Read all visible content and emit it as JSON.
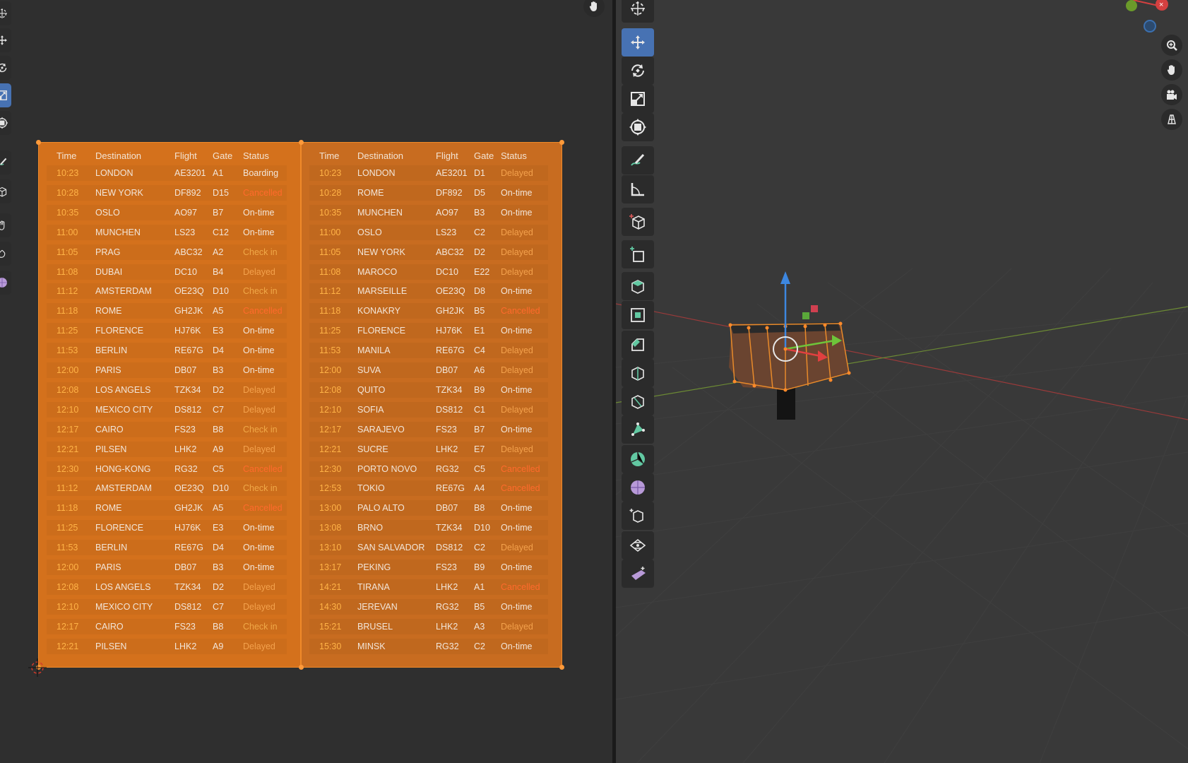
{
  "board": {
    "headers": {
      "time": "Time",
      "destination": "Destination",
      "flight": "Flight",
      "gate": "Gate",
      "status": "Status"
    },
    "left_rows": [
      {
        "time": "10:23",
        "dest": "LONDON",
        "flight": "AE3201",
        "gate": "A1",
        "status": "Boarding",
        "kind": "normal"
      },
      {
        "time": "10:28",
        "dest": "NEW YORK",
        "flight": "DF892",
        "gate": "D15",
        "status": "Cancelled",
        "kind": "cancel"
      },
      {
        "time": "10:35",
        "dest": "OSLO",
        "flight": "AO97",
        "gate": "B7",
        "status": "On-time",
        "kind": "normal"
      },
      {
        "time": "11:00",
        "dest": "MUNCHEN",
        "flight": "LS23",
        "gate": "C12",
        "status": "On-time",
        "kind": "normal"
      },
      {
        "time": "11:05",
        "dest": "PRAG",
        "flight": "ABC32",
        "gate": "A2",
        "status": "Check in",
        "kind": "check"
      },
      {
        "time": "11:08",
        "dest": "DUBAI",
        "flight": "DC10",
        "gate": "B4",
        "status": "Delayed",
        "kind": "delayed"
      },
      {
        "time": "11:12",
        "dest": "AMSTERDAM",
        "flight": "OE23Q",
        "gate": "D10",
        "status": "Check in",
        "kind": "check"
      },
      {
        "time": "11:18",
        "dest": "ROME",
        "flight": "GH2JK",
        "gate": "A5",
        "status": "Cancelled",
        "kind": "cancel"
      },
      {
        "time": "11:25",
        "dest": "FLORENCE",
        "flight": "HJ76K",
        "gate": "E3",
        "status": "On-time",
        "kind": "normal"
      },
      {
        "time": "11:53",
        "dest": "BERLIN",
        "flight": "RE67G",
        "gate": "D4",
        "status": "On-time",
        "kind": "normal"
      },
      {
        "time": "12:00",
        "dest": "PARIS",
        "flight": "DB07",
        "gate": "B3",
        "status": "On-time",
        "kind": "normal"
      },
      {
        "time": "12:08",
        "dest": "LOS ANGELS",
        "flight": "TZK34",
        "gate": "D2",
        "status": "Delayed",
        "kind": "delayed"
      },
      {
        "time": "12:10",
        "dest": "MEXICO CITY",
        "flight": "DS812",
        "gate": "C7",
        "status": "Delayed",
        "kind": "delayed"
      },
      {
        "time": "12:17",
        "dest": "CAIRO",
        "flight": "FS23",
        "gate": "B8",
        "status": "Check in",
        "kind": "check"
      },
      {
        "time": "12:21",
        "dest": "PILSEN",
        "flight": "LHK2",
        "gate": "A9",
        "status": "Delayed",
        "kind": "delayed"
      },
      {
        "time": "12:30",
        "dest": "HONG-KONG",
        "flight": "RG32",
        "gate": "C5",
        "status": "Cancelled",
        "kind": "cancel"
      },
      {
        "time": "11:12",
        "dest": "AMSTERDAM",
        "flight": "OE23Q",
        "gate": "D10",
        "status": "Check in",
        "kind": "check"
      },
      {
        "time": "11:18",
        "dest": "ROME",
        "flight": "GH2JK",
        "gate": "A5",
        "status": "Cancelled",
        "kind": "cancel"
      },
      {
        "time": "11:25",
        "dest": "FLORENCE",
        "flight": "HJ76K",
        "gate": "E3",
        "status": "On-time",
        "kind": "normal"
      },
      {
        "time": "11:53",
        "dest": "BERLIN",
        "flight": "RE67G",
        "gate": "D4",
        "status": "On-time",
        "kind": "normal"
      },
      {
        "time": "12:00",
        "dest": "PARIS",
        "flight": "DB07",
        "gate": "B3",
        "status": "On-time",
        "kind": "normal"
      },
      {
        "time": "12:08",
        "dest": "LOS ANGELS",
        "flight": "TZK34",
        "gate": "D2",
        "status": "Delayed",
        "kind": "delayed"
      },
      {
        "time": "12:10",
        "dest": "MEXICO CITY",
        "flight": "DS812",
        "gate": "C7",
        "status": "Delayed",
        "kind": "delayed"
      },
      {
        "time": "12:17",
        "dest": "CAIRO",
        "flight": "FS23",
        "gate": "B8",
        "status": "Check in",
        "kind": "check"
      },
      {
        "time": "12:21",
        "dest": "PILSEN",
        "flight": "LHK2",
        "gate": "A9",
        "status": "Delayed",
        "kind": "delayed"
      }
    ],
    "right_rows": [
      {
        "time": "10:23",
        "dest": "LONDON",
        "flight": "AE3201",
        "gate": "D1",
        "status": "Delayed",
        "kind": "delayed"
      },
      {
        "time": "10:28",
        "dest": "ROME",
        "flight": "DF892",
        "gate": "D5",
        "status": "On-time",
        "kind": "normal"
      },
      {
        "time": "10:35",
        "dest": "MUNCHEN",
        "flight": "AO97",
        "gate": "B3",
        "status": "On-time",
        "kind": "normal"
      },
      {
        "time": "11:00",
        "dest": "OSLO",
        "flight": "LS23",
        "gate": "C2",
        "status": "Delayed",
        "kind": "delayed"
      },
      {
        "time": "11:05",
        "dest": "NEW YORK",
        "flight": "ABC32",
        "gate": "D2",
        "status": "Delayed",
        "kind": "delayed"
      },
      {
        "time": "11:08",
        "dest": "MAROCO",
        "flight": "DC10",
        "gate": "E22",
        "status": "Delayed",
        "kind": "delayed"
      },
      {
        "time": "11:12",
        "dest": "MARSEILLE",
        "flight": "OE23Q",
        "gate": "D8",
        "status": "On-time",
        "kind": "normal"
      },
      {
        "time": "11:18",
        "dest": "KONAKRY",
        "flight": "GH2JK",
        "gate": "B5",
        "status": "Cancelled",
        "kind": "cancel"
      },
      {
        "time": "11:25",
        "dest": "FLORENCE",
        "flight": "HJ76K",
        "gate": "E1",
        "status": "On-time",
        "kind": "normal"
      },
      {
        "time": "11:53",
        "dest": "MANILA",
        "flight": "RE67G",
        "gate": "C4",
        "status": "Delayed",
        "kind": "delayed"
      },
      {
        "time": "12:00",
        "dest": "SUVA",
        "flight": "DB07",
        "gate": "A6",
        "status": "Delayed",
        "kind": "delayed"
      },
      {
        "time": "12:08",
        "dest": "QUITO",
        "flight": "TZK34",
        "gate": "B9",
        "status": "On-time",
        "kind": "normal"
      },
      {
        "time": "12:10",
        "dest": "SOFIA",
        "flight": "DS812",
        "gate": "C1",
        "status": "Delayed",
        "kind": "delayed"
      },
      {
        "time": "12:17",
        "dest": "SARAJEVO",
        "flight": "FS23",
        "gate": "B7",
        "status": "On-time",
        "kind": "normal"
      },
      {
        "time": "12:21",
        "dest": "SUCRE",
        "flight": "LHK2",
        "gate": "E7",
        "status": "Delayed",
        "kind": "delayed"
      },
      {
        "time": "12:30",
        "dest": "PORTO NOVO",
        "flight": "RG32",
        "gate": "C5",
        "status": "Cancelled",
        "kind": "cancel"
      },
      {
        "time": "12:53",
        "dest": "TOKIO",
        "flight": "RE67G",
        "gate": "A4",
        "status": "Cancelled",
        "kind": "cancel"
      },
      {
        "time": "13:00",
        "dest": "PALO ALTO",
        "flight": "DB07",
        "gate": "B8",
        "status": "On-time",
        "kind": "normal"
      },
      {
        "time": "13:08",
        "dest": "BRNO",
        "flight": "TZK34",
        "gate": "D10",
        "status": "On-time",
        "kind": "normal"
      },
      {
        "time": "13:10",
        "dest": "SAN SALVADOR",
        "flight": "DS812",
        "gate": "C2",
        "status": "Delayed",
        "kind": "delayed"
      },
      {
        "time": "13:17",
        "dest": "PEKING",
        "flight": "FS23",
        "gate": "B9",
        "status": "On-time",
        "kind": "normal"
      },
      {
        "time": "14:21",
        "dest": "TIRANA",
        "flight": "LHK2",
        "gate": "A1",
        "status": "Cancelled",
        "kind": "cancel"
      },
      {
        "time": "14:30",
        "dest": "JEREVAN",
        "flight": "RG32",
        "gate": "B5",
        "status": "On-time",
        "kind": "normal"
      },
      {
        "time": "15:21",
        "dest": "BRUSEL",
        "flight": "LHK2",
        "gate": "A3",
        "status": "Delayed",
        "kind": "delayed"
      },
      {
        "time": "15:30",
        "dest": "MINSK",
        "flight": "RG32",
        "gate": "C2",
        "status": "On-time",
        "kind": "normal"
      }
    ]
  },
  "left_toolbar": {
    "tools": [
      "cursor-icon",
      "move-icon",
      "rotate-icon",
      "scale-icon",
      "transform-icon",
      "annotate-icon",
      "cube-icon",
      "grab-icon",
      "pinch-icon",
      "smooth-icon"
    ],
    "active": "scale-icon"
  },
  "viewport_toolbar": {
    "tools": [
      "cursor-icon",
      "move-icon",
      "rotate-icon",
      "scale-icon",
      "transform-icon",
      "annotate-icon",
      "measure-icon",
      "add-cube-icon",
      "add-primitive-icon",
      "extrude-icon",
      "inset-icon",
      "bevel-icon",
      "loop-cut-icon",
      "knife-icon",
      "poly-build-icon",
      "spin-icon",
      "smooth-icon",
      "shrink-fatten-icon",
      "shear-icon",
      "rip-icon"
    ],
    "active": "move-icon"
  },
  "nav_gizmo": [
    "zoom-icon",
    "hand-icon",
    "camera-icon",
    "grid-view-icon"
  ],
  "colors": {
    "panel": "#d4711c",
    "accent": "#4772b3",
    "cancel": "#ff6a2c",
    "delayed": "#f3a14c"
  }
}
